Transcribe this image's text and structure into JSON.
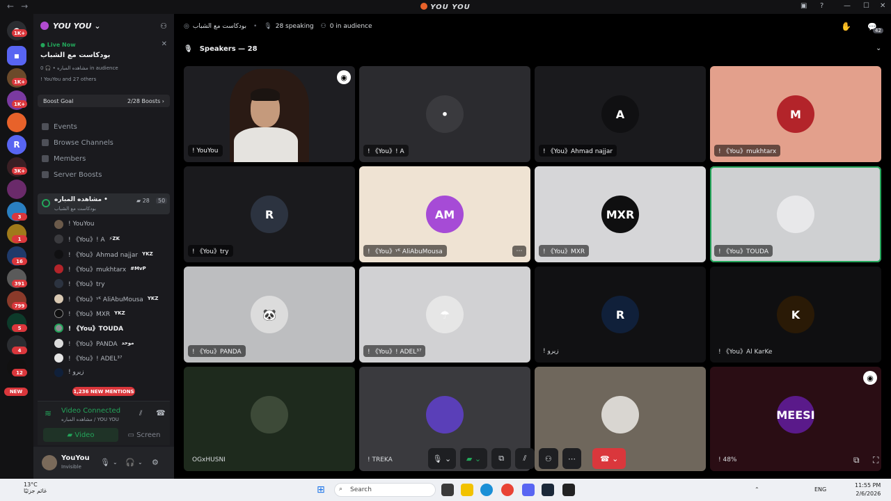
{
  "window": {
    "title": "YOU YOU",
    "nav_back": "←",
    "nav_forward": "→"
  },
  "rail": {
    "badges": [
      "1K+",
      "1K+",
      "1K+",
      "3K+",
      "3",
      "1",
      "16",
      "391",
      "799",
      "5",
      "4",
      "12"
    ],
    "new_label": "NEW"
  },
  "server": {
    "name": "YOU YOU ⌄",
    "live_label": "Live Now",
    "live_title": "بودكاست مع الشباب",
    "live_meta": "مشاهده المباره • 🎧 0 in audience",
    "live_sub": "! YouYou and 27 others",
    "boost_goal_label": "Boost Goal",
    "boost_goal_value": "2/28 Boosts",
    "menu": [
      "Events",
      "Browse Channels",
      "Members",
      "Server Boosts"
    ]
  },
  "voice_channel": {
    "name": "مشاهده المباره •",
    "sub": "بودكاست مع الشباب",
    "count_video": "28",
    "count_limit": "50",
    "users": [
      {
        "name": "! YouYou",
        "tag": ""
      },
      {
        "name": "! 《You》! A",
        "tag": "⚡ZK"
      },
      {
        "name": "! 《You》Ahmad najjar",
        "tag": "YKZ"
      },
      {
        "name": "! 《You》mukhtarx",
        "tag": "#MvP"
      },
      {
        "name": "! 《You》try",
        "tag": ""
      },
      {
        "name": "! 《You》ᵞᴷ AliAbuMousa",
        "tag": "YKZ"
      },
      {
        "name": "! 《You》MXR",
        "tag": "YKZ"
      },
      {
        "name": "! 《You》TOUDA",
        "tag": ""
      },
      {
        "name": "! 《You》PANDA",
        "tag": "موحد"
      },
      {
        "name": "! 《You》! ADEL³⁷",
        "tag": ""
      },
      {
        "name": "! زيرو",
        "tag": ""
      }
    ],
    "mentions": "1,236 NEW MENTIONS"
  },
  "voice_panel": {
    "status": "Video Connected",
    "sub": "مشاهده المباره / YOU YOU",
    "video_label": "Video",
    "screen_label": "Screen"
  },
  "user_panel": {
    "name": "YouYou",
    "status": "Invisible"
  },
  "stage": {
    "channel": "بودكاست مع الشباب",
    "speaking": "28 speaking",
    "audience": "0 in audience",
    "speakers_header": "Speakers — 28",
    "notification_count": "42",
    "tiles": [
      {
        "label": "! YouYou",
        "bg": "#1e1e22",
        "avatar_color": "",
        "avatar_text": "",
        "video": true,
        "pinned": true
      },
      {
        "label": "! 《You》! A",
        "bg": "#2b2b2f",
        "avatar_color": "#3a3a3e",
        "avatar_text": "•"
      },
      {
        "label": "! 《You》Ahmad najjar",
        "bg": "#1a1a1d",
        "avatar_color": "#101012",
        "avatar_text": "A"
      },
      {
        "label": "! 《You》mukhtarx",
        "bg": "#e3a08c",
        "avatar_color": "#b3242a",
        "avatar_text": "M"
      },
      {
        "label": "! 《You》try",
        "bg": "#1a1a1d",
        "avatar_color": "#2c3340",
        "avatar_text": "R"
      },
      {
        "label": "! 《You》ᵞᴷ AliAbuMousa",
        "bg": "#efe3d3",
        "avatar_color": "#a64bd6",
        "avatar_text": "AM",
        "more": true
      },
      {
        "label": "! 《You》MXR",
        "bg": "#d6d6d8",
        "avatar_color": "#0f0f10",
        "avatar_text": "MXR"
      },
      {
        "label": "! 《You》TOUDA",
        "bg": "#cfd0d2",
        "avatar_color": "#e8e8ea",
        "avatar_text": "",
        "speaking": true
      },
      {
        "label": "! 《You》PANDA",
        "bg": "#bdbec0",
        "avatar_color": "#dcdcdc",
        "avatar_text": "🐼"
      },
      {
        "label": "! 《You》! ADEL³⁷",
        "bg": "#d1d1d3",
        "avatar_color": "#e6e6e6",
        "avatar_text": "☂"
      },
      {
        "label": "! زيرو",
        "bg": "#111113",
        "avatar_color": "#10203a",
        "avatar_text": "R",
        "plain": true
      },
      {
        "label": "! 《You》Al KarKe",
        "bg": "#0f0f11",
        "avatar_color": "#2a1a06",
        "avatar_text": "K",
        "plain": true
      },
      {
        "label": "OGxHUSNI",
        "bg": "#1e2a1d",
        "avatar_color": "#3d4a38",
        "avatar_text": "",
        "plain": true
      },
      {
        "label": "! TREKA",
        "bg": "#3a3a3e",
        "avatar_color": "#5a3fb8",
        "avatar_text": "",
        "plain": true
      },
      {
        "label": "",
        "bg": "#6f675c",
        "avatar_color": "#d9d6d1",
        "avatar_text": "",
        "plain": true
      },
      {
        "label": "! 48%",
        "bg": "#2a0d14",
        "avatar_color": "#5a1a8a",
        "avatar_text": "MEESI",
        "plain": true,
        "pinned": true
      }
    ]
  },
  "taskbar": {
    "weather_temp": "13°C",
    "weather_desc": "غائم جزئيًا",
    "search": "Search",
    "lang": "ENG",
    "time": "11:55 PM",
    "date": "2/6/2026"
  },
  "colors": {
    "accent_green": "#23a55a",
    "danger_red": "#da373c"
  }
}
